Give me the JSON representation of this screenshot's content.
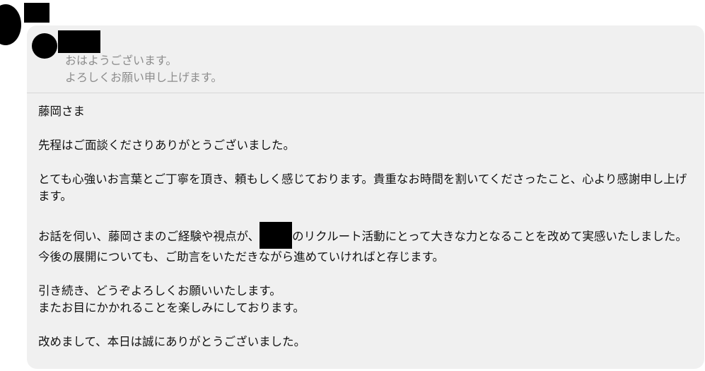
{
  "quoted_message": {
    "line1": "おはようございます。",
    "line2": "よろしくお願い申し上げます。"
  },
  "message": {
    "greeting": "藤岡さま",
    "p1": "先程はご面談くださりありがとうございました。",
    "p2": "とても心強いお言葉とご丁寧を頂き、頼もしく感じております。貴重なお時間を割いてくださったこと、心より感謝申し上げます。",
    "p3_before": "お話を伺い、藤岡さまのご経験や視点が、",
    "p3_after": "のリクルート活動にとって大きな力となることを改めて実感いたしました。今後の展開についても、ご助言をいただきながら進めていければと存じます。",
    "p4_line1": "引き続き、どうぞよろしくお願いいたします。",
    "p4_line2": "またお目にかかれることを楽しみにしております。",
    "p5": "改めまして、本日は誠にありがとうございました。"
  }
}
